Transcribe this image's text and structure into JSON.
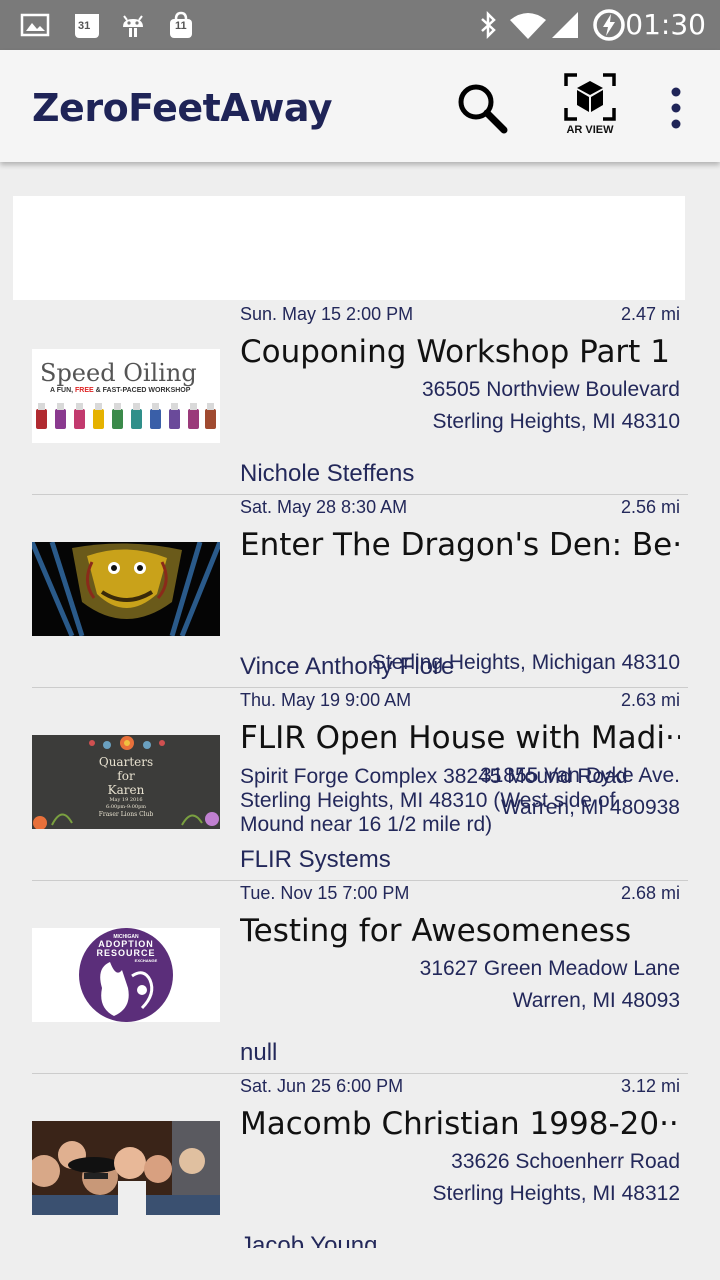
{
  "status_bar": {
    "time": "01:30",
    "calendar_day": "31",
    "bag_count": "11",
    "icons": [
      "image-icon",
      "calendar-icon",
      "android-icon",
      "shopping-bag-icon",
      "bluetooth-icon",
      "wifi-icon",
      "signal-icon",
      "battery-charging-icon"
    ]
  },
  "app_bar": {
    "title": "ZeroFeetAway",
    "ar_view_label": "AR VIEW"
  },
  "events": [
    {
      "date": "Sun. May 15 2:00 PM",
      "distance": "2.47 mi",
      "title": "Couponing Workshop Part 1",
      "address_line1": "36505 Northview Boulevard",
      "address_line2": "Sterling Heights, MI 48310",
      "organizer": "Nichole Steffens",
      "thumb": {
        "heading": "Speed Oiling",
        "subheading_a": "A FUN, ",
        "subheading_b": "FREE",
        "subheading_c": " & FAST-PACED WORKSHOP"
      }
    },
    {
      "date": "Sat. May 28 8:30 AM",
      "distance": "2.56 mi",
      "title": "Enter The Dragon's Den: Be··",
      "address_multiline": "Spirit Forge Complex 38245 Mound Road Sterling Heights, MI 48310    (West side of Mound near 16 1/2 mile rd)",
      "address_line2": "Sterling Heights, Michigan 48310",
      "organizer": "Vince Anthony Flore"
    },
    {
      "date": "Thu. May 19 9:00 AM",
      "distance": "2.63 mi",
      "title": "FLIR Open House with Madi··",
      "address_line1": "31855 Van Dyke Ave.",
      "address_line2": "Warren, MI 480938",
      "organizer": "FLIR Systems",
      "thumb": {
        "line1": "Quarters",
        "line2": "for",
        "line3": "Karen",
        "line4": "May 19 2016",
        "line5": "6:00pm-9:00pm",
        "line6": "Fraser Lions Club"
      }
    },
    {
      "date": "Tue. Nov 15 7:00 PM",
      "distance": "2.68 mi",
      "title": "Testing for Awesomeness",
      "address_line1": "31627 Green Meadow Lane",
      "address_line2": "Warren, MI 48093",
      "organizer": "null",
      "thumb": {
        "line1": "MICHIGAN",
        "line2": "ADOPTION",
        "line3": "RESOURCE",
        "line4": "EXCHANGE"
      }
    },
    {
      "date": "Sat. Jun 25 6:00 PM",
      "distance": "3.12 mi",
      "title": "Macomb Christian 1998-20··",
      "address_line1": "33626 Schoenherr Road",
      "address_line2": "Sterling Heights, MI 48312",
      "organizer": "Jacob Young"
    }
  ],
  "colors": {
    "status_bar": "#7a7a7a",
    "app_bar": "#f5f5f5",
    "title_text": "#1f2457",
    "link_text": "#23285a",
    "background": "#eeeeee"
  }
}
